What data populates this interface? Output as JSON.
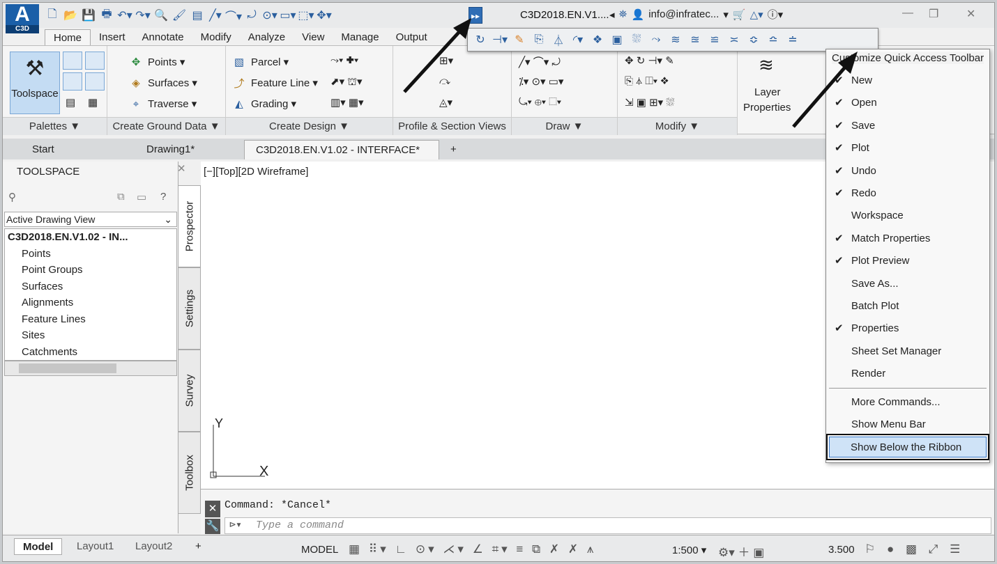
{
  "app": {
    "logo_letter": "A",
    "logo_sub": "C3D",
    "title": "C3D2018.EN.V1....",
    "user": "info@infratec...",
    "colors": {
      "accent": "#2f6db5",
      "highlight": "#cfe3f7"
    }
  },
  "ribbon_tabs": [
    "Home",
    "Insert",
    "Annotate",
    "Modify",
    "Analyze",
    "View",
    "Manage",
    "Output"
  ],
  "panels": {
    "palettes": {
      "title": "Palettes ▼",
      "toolspace": "Toolspace"
    },
    "ground": {
      "title": "Create Ground Data ▼",
      "points": "Points ▾",
      "surfaces": "Surfaces ▾",
      "traverse": "Traverse ▾"
    },
    "design": {
      "title": "Create Design ▼",
      "parcel": "Parcel ▾",
      "feature_line": "Feature Line ▾",
      "grading": "Grading ▾"
    },
    "profile": {
      "title": "Profile & Section Views"
    },
    "draw": {
      "title": "Draw ▼"
    },
    "modify": {
      "title": "Modify ▼"
    },
    "layer": {
      "label1": "Layer",
      "label2": "Properties"
    }
  },
  "doc_tabs": {
    "start": "Start",
    "drawing1": "Drawing1*",
    "active": "C3D2018.EN.V1.02 - INTERFACE*",
    "close": "✕",
    "add": "+"
  },
  "toolspace": {
    "title": "TOOLSPACE",
    "view_select": "Active Drawing View",
    "tree": [
      "C3D2018.EN.V1.02 - IN...",
      "Points",
      "Point Groups",
      "Surfaces",
      "Alignments",
      "Feature Lines",
      "Sites",
      "Catchments"
    ]
  },
  "side_tabs": [
    "Prospector",
    "Settings",
    "Survey",
    "Toolbox"
  ],
  "viewport": {
    "label": "[−][Top][2D Wireframe]",
    "y_axis": "Y",
    "x_axis": "X"
  },
  "command": {
    "output": "Command: *Cancel*",
    "placeholder": "Type a command"
  },
  "status": {
    "model_tab": "Model",
    "layout1": "Layout1",
    "layout2": "Layout2",
    "add": "+",
    "model": "MODEL",
    "scale": "1:500 ▾",
    "lineweight": "3.500"
  },
  "menu": {
    "title": "Customize Quick Access Toolbar",
    "items": [
      {
        "label": "New",
        "checked": "✔"
      },
      {
        "label": "Open",
        "checked": "✔"
      },
      {
        "label": "Save",
        "checked": "✔"
      },
      {
        "label": "Plot",
        "checked": "✔"
      },
      {
        "label": "Undo",
        "checked": "✔"
      },
      {
        "label": "Redo",
        "checked": "✔"
      },
      {
        "label": "Workspace",
        "checked": ""
      },
      {
        "label": "Match Properties",
        "checked": "✔"
      },
      {
        "label": "Plot Preview",
        "checked": "✔"
      },
      {
        "label": "Save As...",
        "checked": ""
      },
      {
        "label": "Batch Plot",
        "checked": ""
      },
      {
        "label": "Properties",
        "checked": "✔"
      },
      {
        "label": "Sheet Set Manager",
        "checked": ""
      },
      {
        "label": "Render",
        "checked": ""
      }
    ],
    "more": "More Commands...",
    "menubar": "Show Menu Bar",
    "below": "Show Below the Ribbon"
  }
}
